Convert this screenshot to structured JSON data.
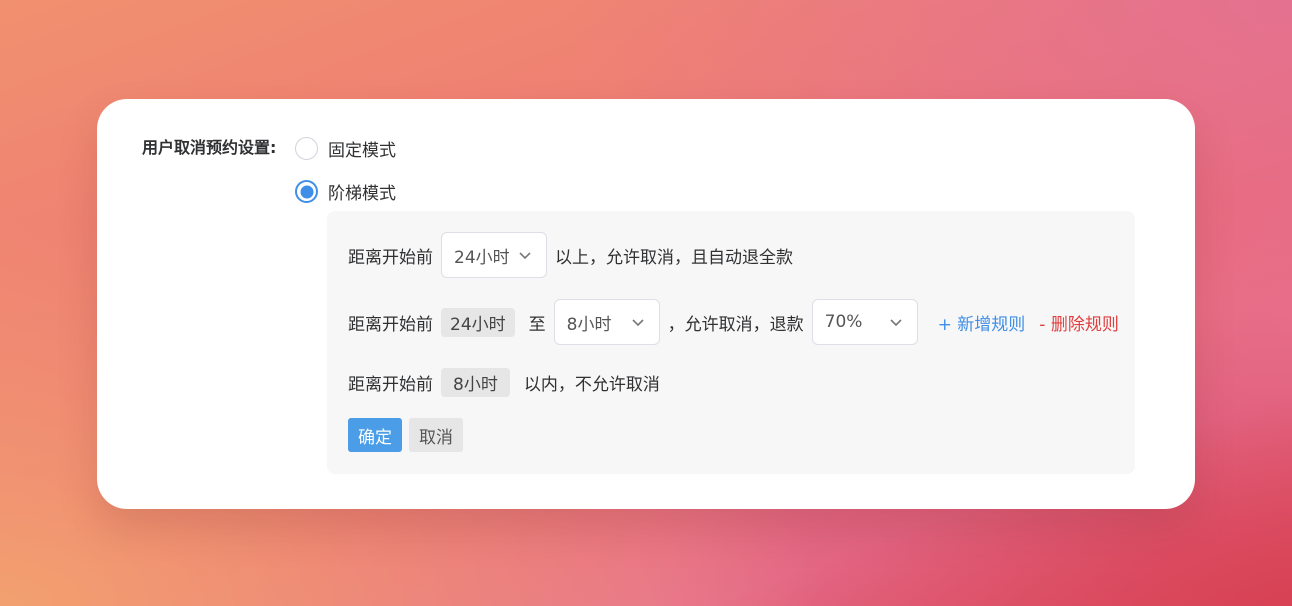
{
  "setting": {
    "label": "用户取消预约设置:",
    "modes": [
      {
        "label": "固定模式",
        "checked": false
      },
      {
        "label": "阶梯模式",
        "checked": true
      }
    ]
  },
  "rules": {
    "row1": {
      "prefix": "距离开始前",
      "select_value": "24小时",
      "suffix": "以上，允许取消，且自动退全款"
    },
    "row2": {
      "prefix": "距离开始前",
      "from_tag": "24小时",
      "to_text": "至",
      "select_value": "8小时",
      "middle_text": "，允许取消，退款",
      "refund_value": "70%",
      "add_rule": "+ 新增规则",
      "delete_rule": "- 删除规则"
    },
    "row3": {
      "prefix": "距离开始前",
      "tag": "8小时",
      "suffix": "以内，不允许取消"
    }
  },
  "buttons": {
    "confirm": "确定",
    "cancel": "取消"
  },
  "colors": {
    "accent": "#3f8fe8",
    "danger": "#e03e3e",
    "primary_button": "#4a9de6"
  },
  "icons": {
    "select_arrow": "chevron-down-icon"
  }
}
